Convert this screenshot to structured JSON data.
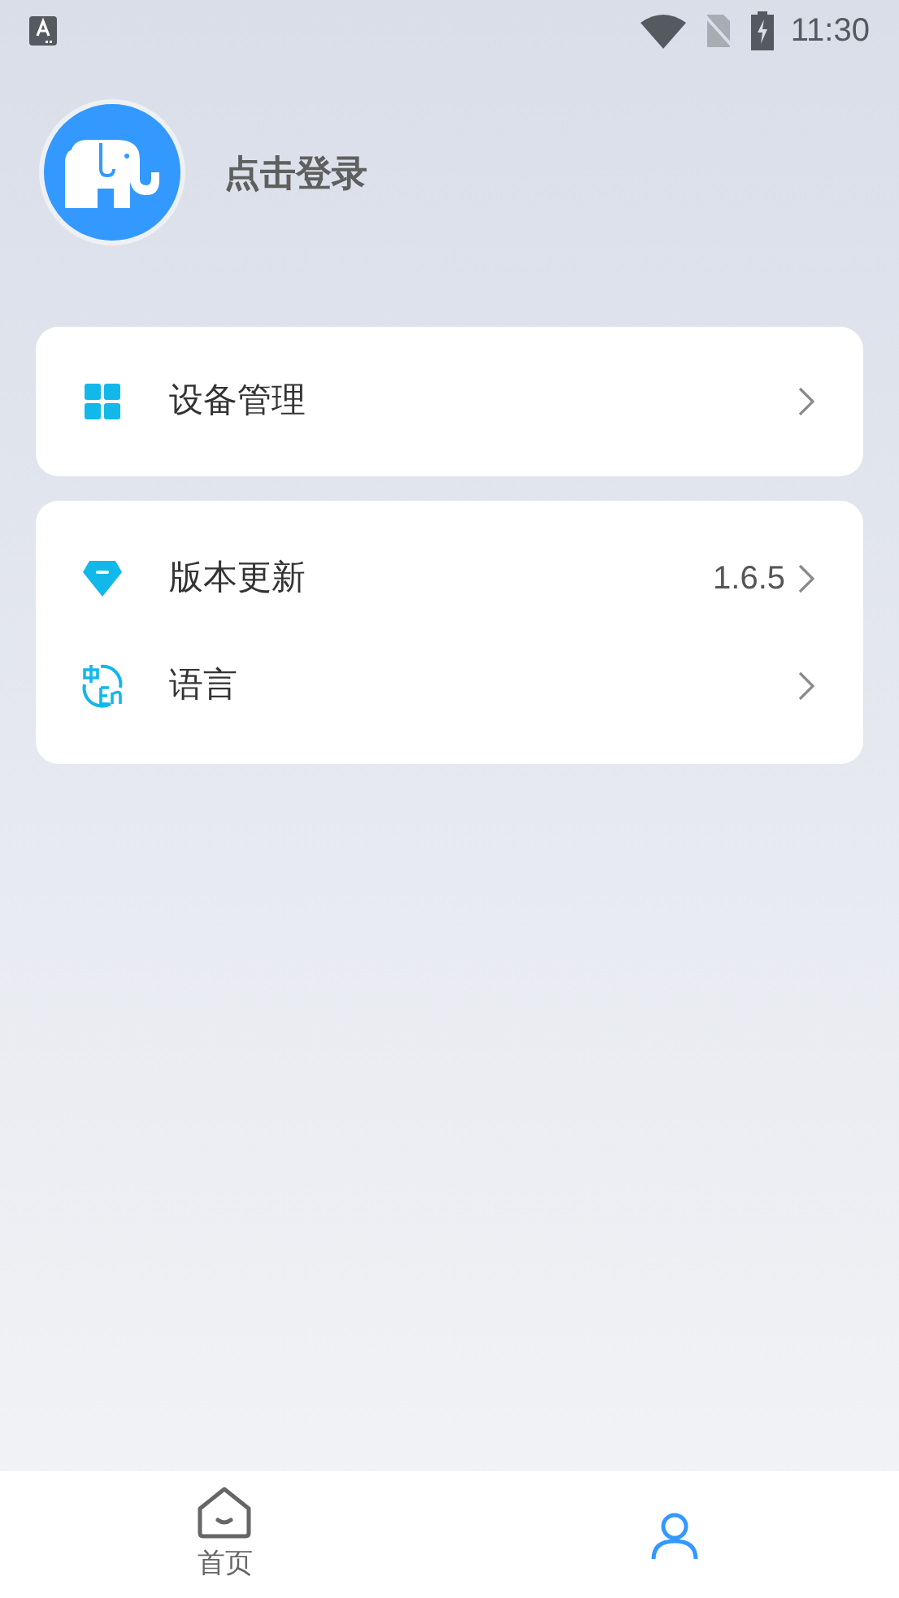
{
  "status_bar": {
    "time": "11:30"
  },
  "profile": {
    "label": "点击登录"
  },
  "groups": [
    {
      "items": [
        {
          "kind": "grid",
          "label": "设备管理"
        }
      ]
    },
    {
      "items": [
        {
          "kind": "gem",
          "label": "版本更新",
          "value": "1.6.5"
        },
        {
          "kind": "language",
          "label": "语言"
        }
      ]
    }
  ],
  "tabs": [
    {
      "kind": "home",
      "label": "首页",
      "selected": false
    },
    {
      "kind": "person",
      "selected": true
    }
  ]
}
